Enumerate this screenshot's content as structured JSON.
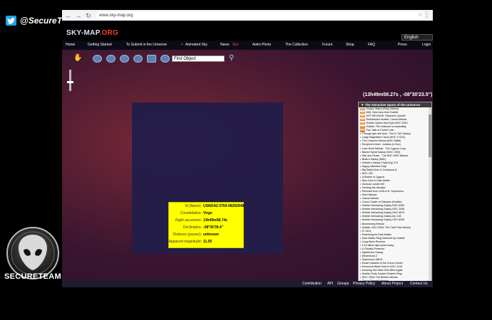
{
  "overlay": {
    "twitter_handle": "@SecureTeam10",
    "logo_text": "SECURETEAM"
  },
  "browser": {
    "url": "www.sky-map.org"
  },
  "site": {
    "logo_main": "SKY-MAP",
    "logo_suffix": ".ORG",
    "language": "English",
    "nav": [
      {
        "label": "Home"
      },
      {
        "label": "Getting Started"
      },
      {
        "label": "To Submit in the Universe"
      },
      {
        "label": "Animated Sky"
      },
      {
        "label": "News"
      },
      {
        "label": "Sky"
      },
      {
        "label": "Astro Photo"
      },
      {
        "label": "The Collection"
      },
      {
        "label": "Forum"
      },
      {
        "label": "Shop"
      },
      {
        "label": "FAQ"
      },
      {
        "label": "Press"
      },
      {
        "label": "Login"
      }
    ]
  },
  "sky": {
    "search_placeholder": "Find Object",
    "coordinates": "(13h49m58.27s , -08°30'23.5\")"
  },
  "popup": {
    "rows": [
      {
        "label": "Id (Name):",
        "value": "USNOA2 0750-08250948"
      },
      {
        "label": "Constellation:",
        "value": "Virgo"
      },
      {
        "label": "Right ascension:",
        "value": "13h49m58.74s"
      },
      {
        "label": "Declination:",
        "value": "-08°30'30.4\""
      },
      {
        "label": "Distance (parsec):",
        "value": "unknown"
      },
      {
        "label": "Apparent magnitude:",
        "value": "11.55"
      }
    ]
  },
  "panel": {
    "title": "The Attractive Spots of the Universe",
    "items": [
      {
        "badge": "NEW",
        "text": "Hoag's Object (Ring Galaxy)"
      },
      {
        "badge": "NEW",
        "text": "M81: New view from Hubble"
      },
      {
        "badge": "NEW",
        "text": "HST RELEASE: Stephan's Quintet"
      },
      {
        "badge": "NEW",
        "text": "Refurbished Hubble: Carina Nebula"
      },
      {
        "badge": "NEW",
        "text": "Hubble Opens New Eyes NGC 6302"
      },
      {
        "badge": "NEW",
        "text": "Hubble: The Universe is expanding"
      },
      {
        "badge": "NEW",
        "text": "Two Tails of Comet Lulin"
      },
      {
        "badge": "",
        "text": "Through gas and dust - The IC 342 Galaxy"
      },
      {
        "badge": "",
        "text": "Large Magellanic Cloud (NGC 17222)"
      },
      {
        "badge": "",
        "text": "The Crescent Nebula (NGC 6888)"
      },
      {
        "badge": "",
        "text": "Scorpion's heart - Antares (α Sco)"
      },
      {
        "badge": "",
        "text": "Lace Work Nebula - The Cygnus Loop"
      },
      {
        "badge": "",
        "text": "Barred Spiral Galaxy (NGC 1300)"
      },
      {
        "badge": "",
        "text": "War and Peace - The NGC 6357 Nebula"
      },
      {
        "badge": "",
        "text": "Bode's Galaxy (M81)"
      },
      {
        "badge": "",
        "text": "Hubble's Galaxy Triplet Arp 274"
      },
      {
        "badge": "",
        "text": "Happy Valentine Day!"
      },
      {
        "badge": "",
        "text": "Big Radio Burn in Centaurus A"
      },
      {
        "badge": "",
        "text": "NGC 253"
      },
      {
        "badge": "",
        "text": "A Bubble in Cygnus"
      },
      {
        "badge": "",
        "text": "New Clue to Dark Matter"
      },
      {
        "badge": "",
        "text": "Globular cluster M5"
      },
      {
        "badge": "",
        "text": "Feeding the Monster"
      },
      {
        "badge": "",
        "text": "Remnant from 1006 A.D. Supernova"
      },
      {
        "badge": "",
        "text": "Helix Nebula"
      },
      {
        "badge": "",
        "text": "Carina Nebula"
      },
      {
        "badge": "",
        "text": "Coma Cluster of Galaxies (Hubble)"
      },
      {
        "badge": "",
        "text": "Hubble Interacting Galaxy NGC 6050"
      },
      {
        "badge": "",
        "text": "Hubble Interacting Galaxy NGC 2936"
      },
      {
        "badge": "",
        "text": "Hubble Interacting Galaxy NGC 5679"
      },
      {
        "badge": "",
        "text": "Hubble Interacting Galaxy Arp 148"
      },
      {
        "badge": "",
        "text": "Hubble Interacting Galaxy UGC 8335"
      },
      {
        "badge": "",
        "text": "Boomerang Nebula"
      },
      {
        "badge": "",
        "text": "Hubble: NGC 6334: The Cat's Paw Nebula"
      },
      {
        "badge": "",
        "text": "IC 1613"
      },
      {
        "badge": "",
        "text": "Searching for Dark Matter"
      },
      {
        "badge": "",
        "text": "Dark Matter Ring Detected by Hubble"
      },
      {
        "badge": "",
        "text": "Long Wave Reverse"
      },
      {
        "badge": "",
        "text": "13.6 billion light-years away..."
      },
      {
        "badge": "",
        "text": "A Ghostly Presence"
      },
      {
        "badge": "",
        "text": "Mysterious Galaxy"
      },
      {
        "badge": "",
        "text": "Westerlund 2"
      },
      {
        "badge": "",
        "text": "Supernova 1987A"
      },
      {
        "badge": "",
        "text": "Dwarf Galaxies in the Coma Cluster"
      },
      {
        "badge": "",
        "text": "Enormous Black Hole in NGC 1128"
      },
      {
        "badge": "",
        "text": "Amazing Old Stars Give Birth Again"
      },
      {
        "badge": "",
        "text": "Hubble Finds Double Einstein Ring"
      },
      {
        "badge": "",
        "text": "NGC 7635: The Bubble Nebula"
      },
      {
        "badge": "",
        "text": "Thor's Emerald Helmet"
      },
      {
        "badge": "",
        "text": "Double Supernova Remnants DEM L316"
      },
      {
        "badge": "",
        "text": "NGC 4622 - unique configuration of arms"
      },
      {
        "badge": "",
        "text": "The Pinwheel Galaxy (Abell406)"
      },
      {
        "badge": "",
        "text": "Silverado Galaxy (NGC 3370)"
      },
      {
        "badge": "",
        "text": "Comet 8P/Tuttle flying by M33 galaxy"
      },
      {
        "badge": "",
        "text": "Comet 8P/Tuttle"
      }
    ]
  },
  "footer": {
    "links": [
      "Contribution",
      "API",
      "Groups",
      "Privacy Policy",
      "About Project",
      "Contact Us"
    ]
  }
}
